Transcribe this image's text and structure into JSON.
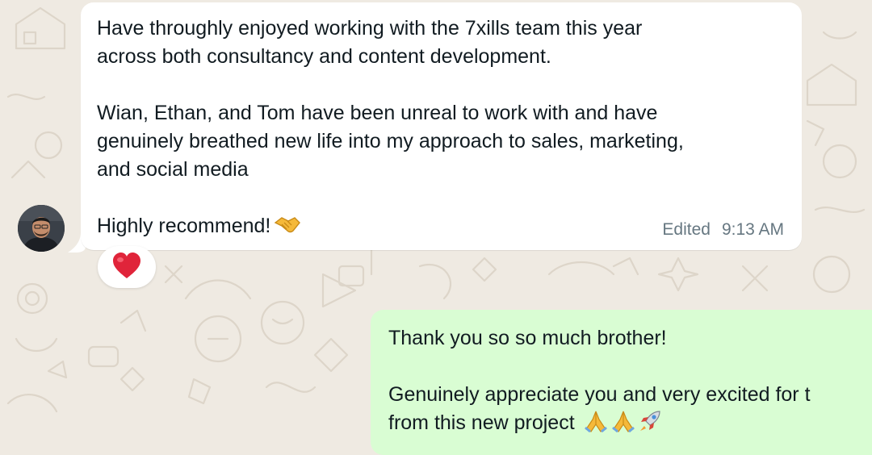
{
  "chat": {
    "incoming_message": {
      "paragraph_1": "Have throughly enjoyed working with the 7xills team this year\nacross both consultancy and content development.",
      "paragraph_2": "Wian, Ethan, and Tom have been unreal to work with and have\ngenuinely breathed new life into my approach to sales, marketing,\nand social media",
      "paragraph_3": "Highly recommend!",
      "edited_label": "Edited",
      "time": "9:13 AM",
      "reaction": "❤️",
      "reaction_icon": "red-heart",
      "end_emoji_icon": "handshake"
    },
    "outgoing_message": {
      "paragraph_1": "Thank you so so much brother!",
      "paragraph_2": "Genuinely appreciate you and very excited for t\nfrom this new project",
      "emoji_icons": [
        "folded-hands",
        "folded-hands",
        "rocket"
      ]
    },
    "colors": {
      "chat_background": "#efeae2",
      "incoming_bubble": "#ffffff",
      "outgoing_bubble": "#d9fdd3",
      "text": "#111b21",
      "meta_text": "#667781",
      "reaction_heart": "#e0243a"
    }
  }
}
